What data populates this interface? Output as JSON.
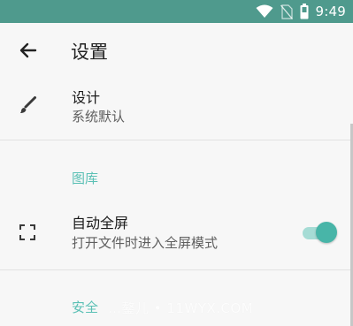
{
  "status_bar": {
    "time": "9:49",
    "icons": [
      "wifi-icon",
      "no-sim-icon",
      "battery-icon"
    ],
    "color": "#4f9a8d"
  },
  "toolbar": {
    "back_icon": "arrow-left-icon",
    "title": "设置"
  },
  "settings": {
    "design": {
      "icon": "brush-icon",
      "title": "设计",
      "summary": "系统默认"
    },
    "gallery_category": "图库",
    "fullscreen": {
      "icon": "fullscreen-icon",
      "title": "自动全屏",
      "summary": "打开文件时进入全屏模式",
      "enabled": true
    },
    "security_category": "安全"
  },
  "watermark": "…鏊儿 • 11WYX.COM",
  "colors": {
    "accent": "#5bc0b5",
    "toggle_thumb": "#48b5a8",
    "toggle_track": "#a6dcd5"
  }
}
